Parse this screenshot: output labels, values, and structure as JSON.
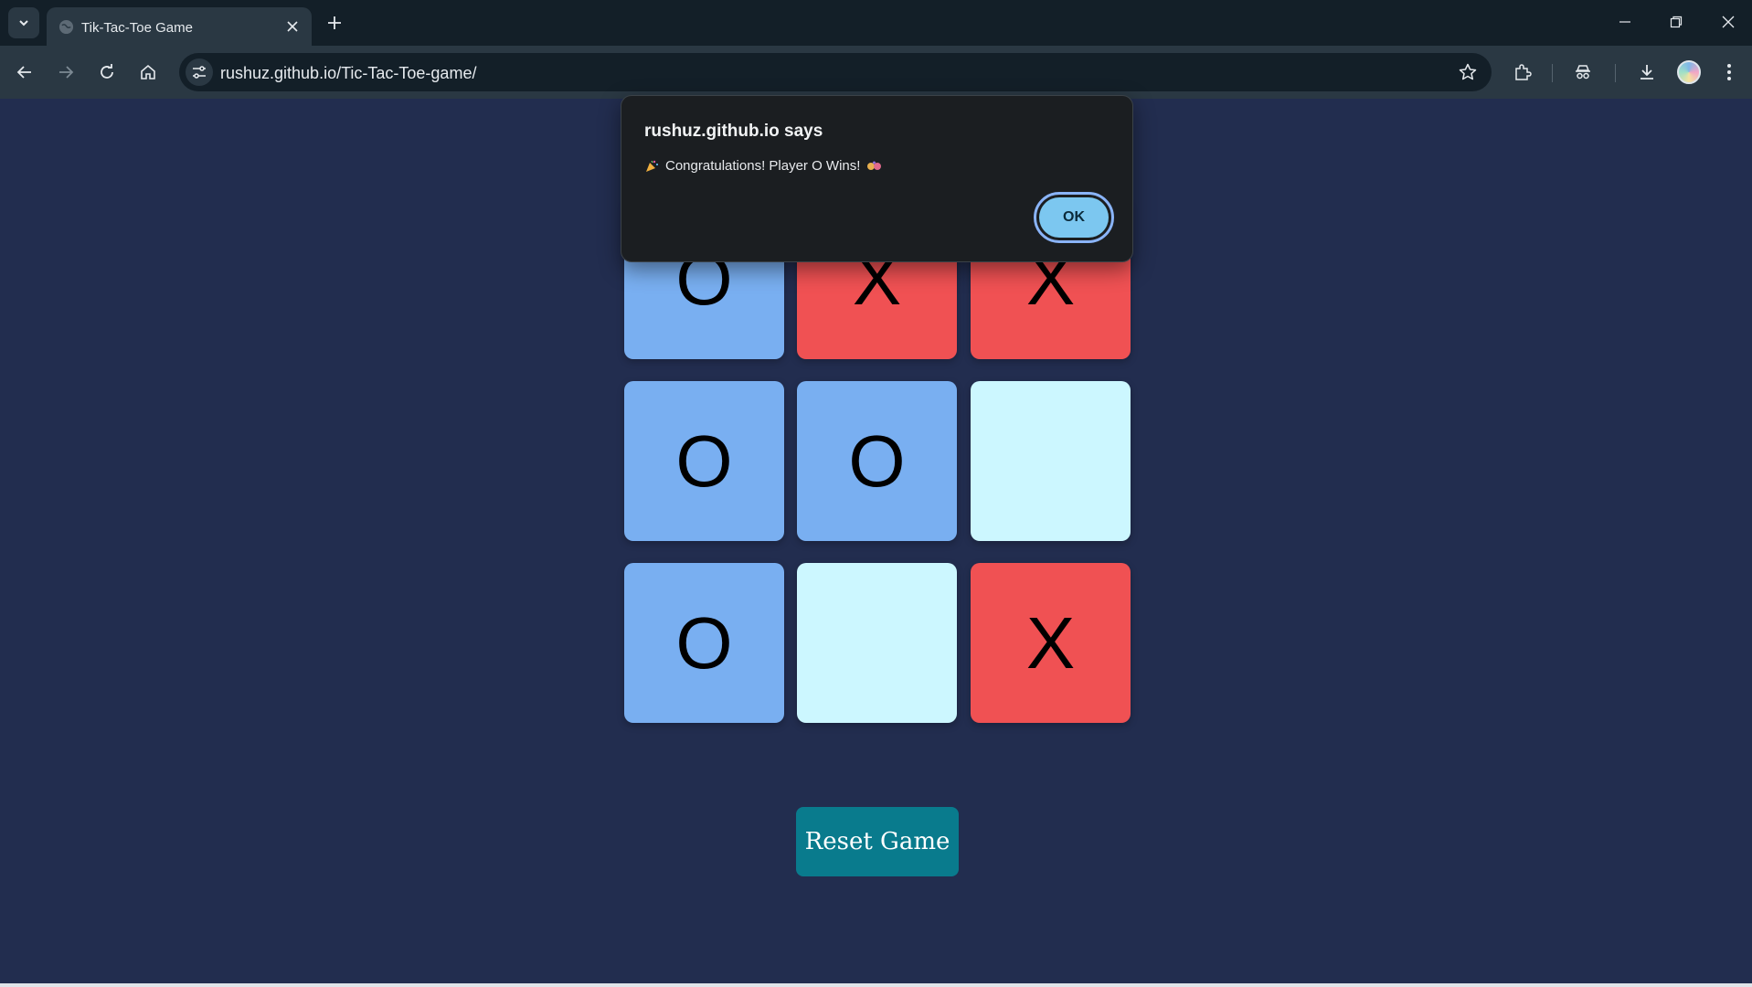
{
  "browser": {
    "tab_title": "Tik-Tac-Toe Game",
    "url": "rushuz.github.io/Tic-Tac-Toe-game/"
  },
  "board": {
    "cells": [
      {
        "mark": "O",
        "state": "o"
      },
      {
        "mark": "X",
        "state": "x"
      },
      {
        "mark": "X",
        "state": "x"
      },
      {
        "mark": "O",
        "state": "o"
      },
      {
        "mark": "O",
        "state": "o"
      },
      {
        "mark": "",
        "state": "empty"
      },
      {
        "mark": "O",
        "state": "o"
      },
      {
        "mark": "",
        "state": "empty"
      },
      {
        "mark": "X",
        "state": "x"
      }
    ],
    "colors": {
      "o": "#79aff1",
      "x": "#f05153",
      "empty": "#ccf7ff"
    }
  },
  "reset_label": "Reset Game",
  "dialog": {
    "title": "rushuz.github.io says",
    "message": "Congratulations! Player O Wins!",
    "ok_label": "OK"
  },
  "icons": {
    "message_leading": "party-popper-icon",
    "message_trailing": "celebration-icon"
  }
}
